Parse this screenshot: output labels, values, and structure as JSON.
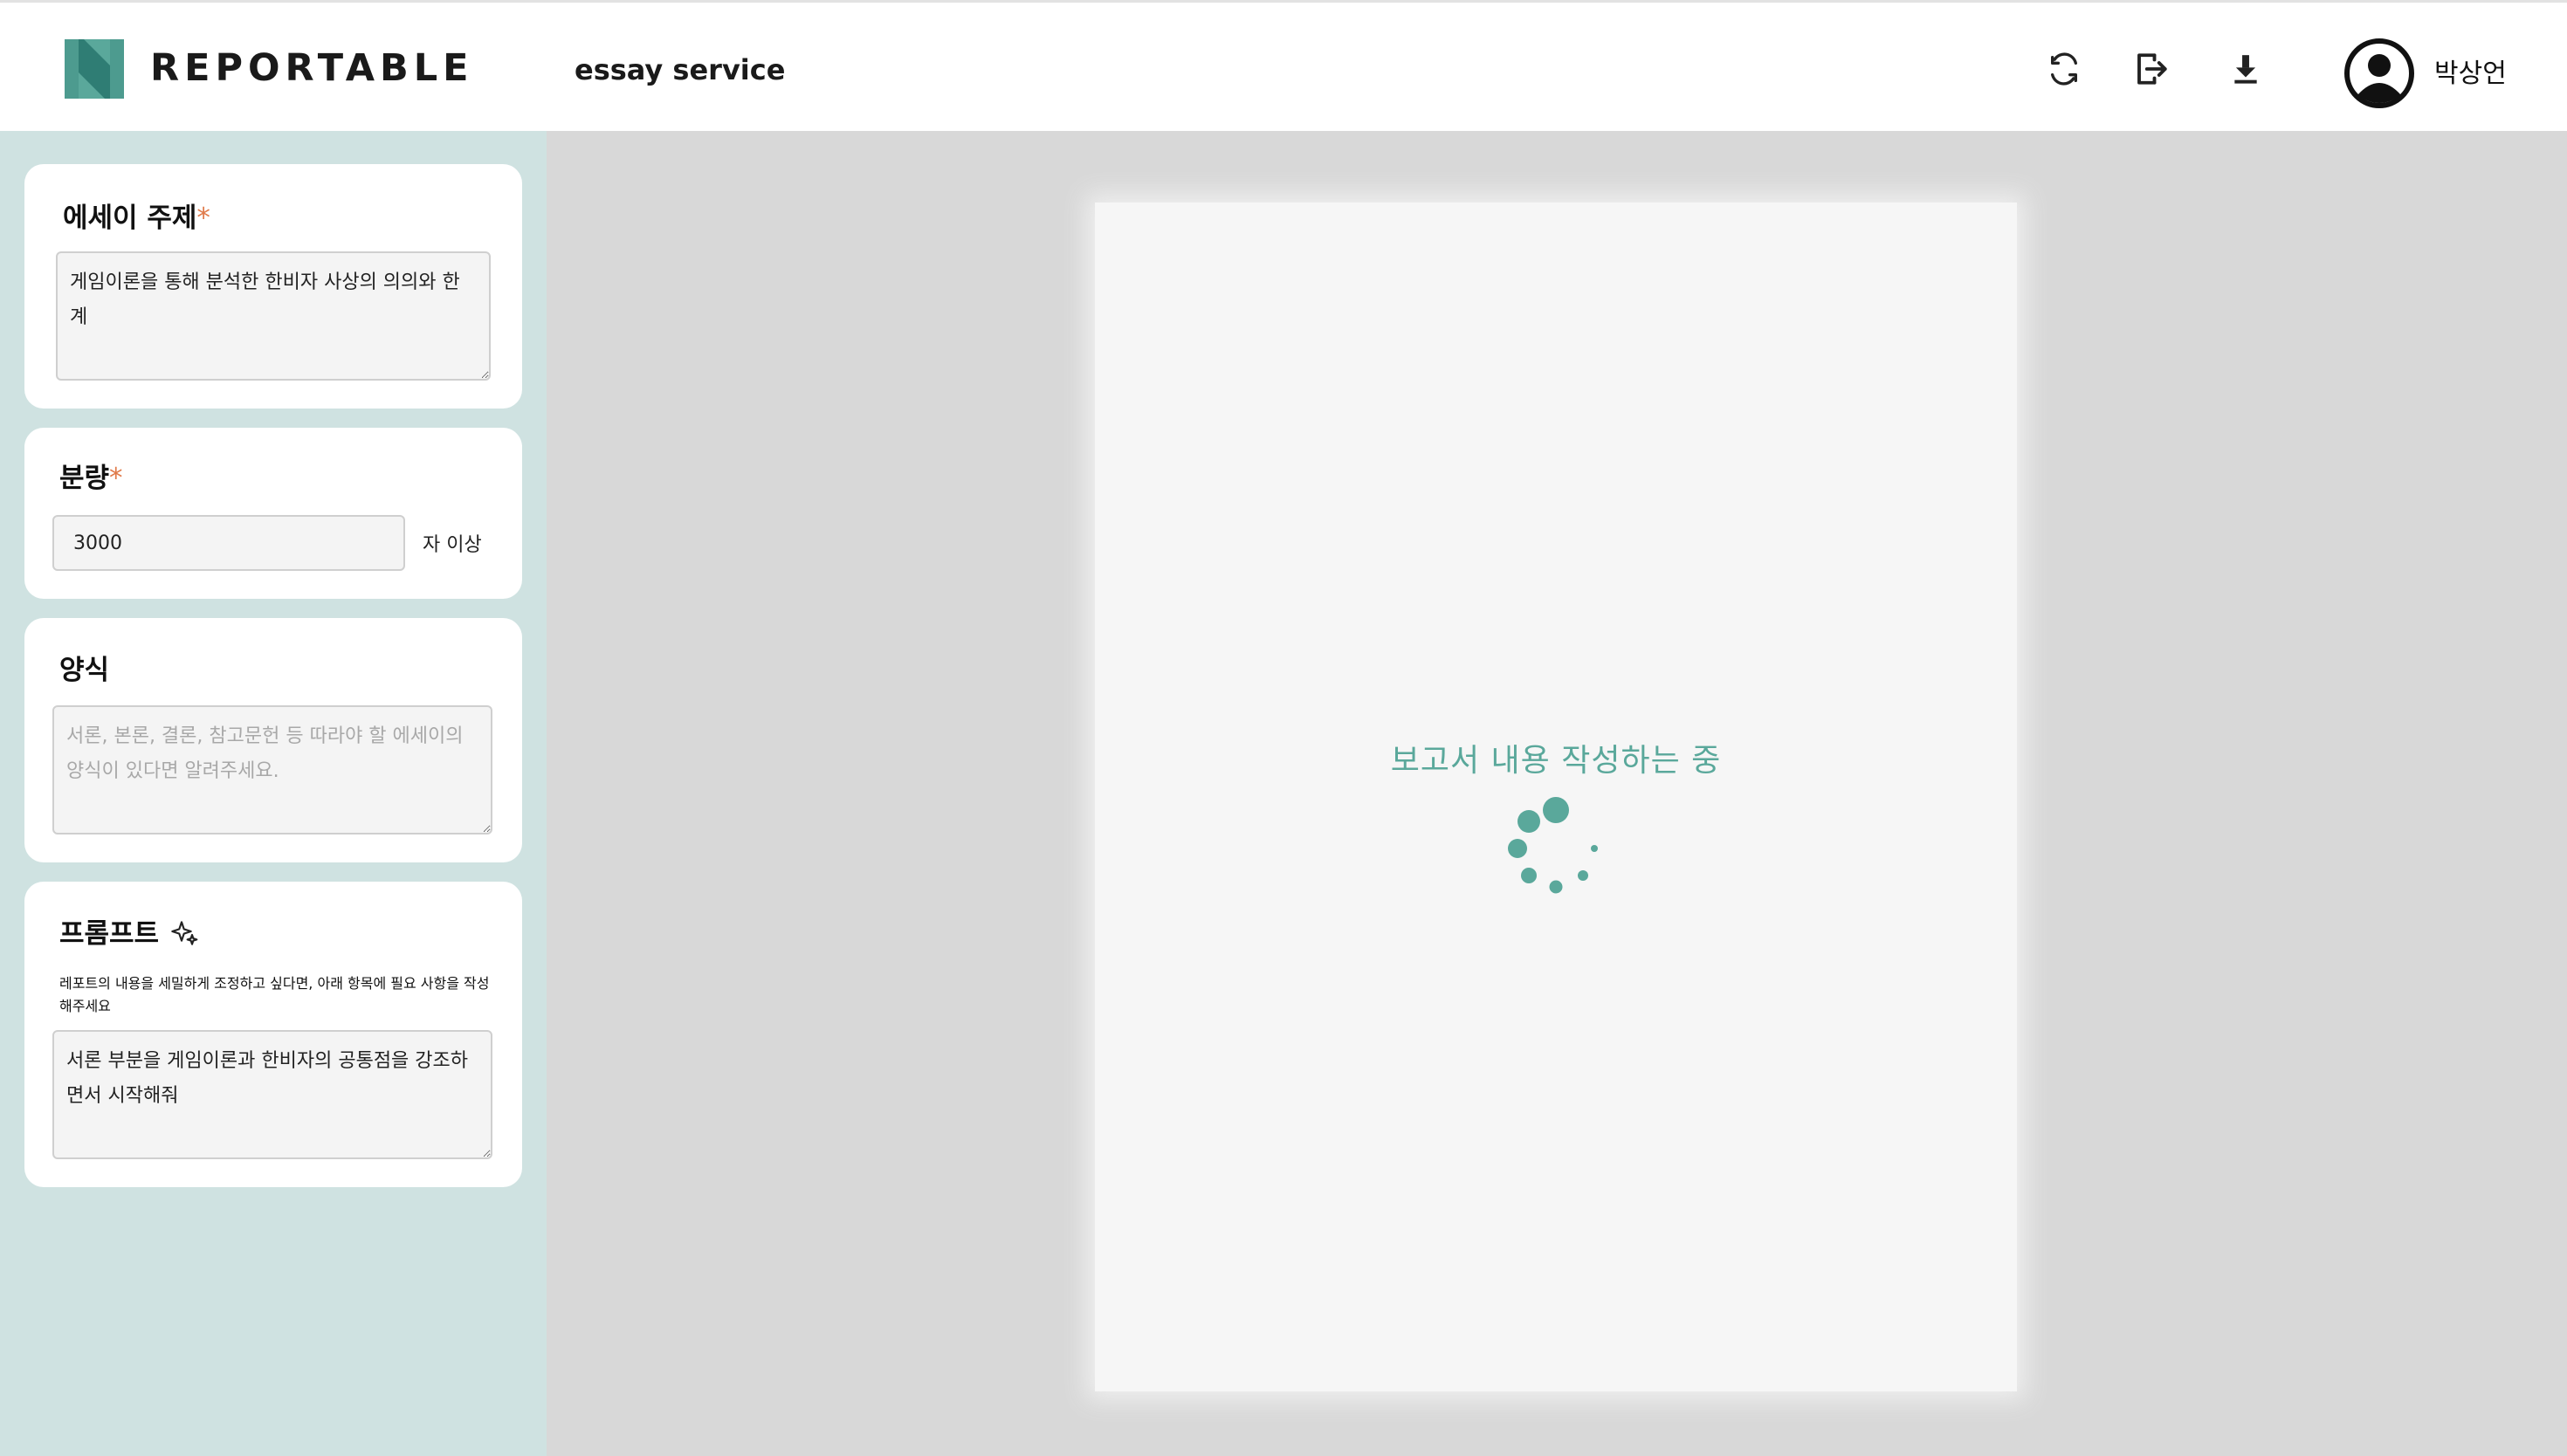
{
  "header": {
    "brand": "REPORTABLE",
    "service": "essay service",
    "user_name": "박상언",
    "icons": [
      "refresh-icon",
      "export-icon",
      "download-icon",
      "user-avatar-icon"
    ]
  },
  "colors": {
    "accent": "#5aa89b",
    "sidebar_bg": "#cfe2e1",
    "main_bg": "#d8d8d8",
    "required_mark": "#e07a4a"
  },
  "sidebar": {
    "topic": {
      "label": "에세이 주제",
      "required_mark": "*",
      "value": "게임이론을 통해 분석한 한비자 사상의 의의와 한계"
    },
    "length": {
      "label": "분량",
      "required_mark": "*",
      "value": "3000",
      "suffix": "자 이상"
    },
    "format": {
      "label": "양식",
      "placeholder": "서론, 본론, 결론, 참고문헌 등 따라야 할 에세이의 양식이 있다면 알려주세요."
    },
    "prompt": {
      "label": "프롬프트",
      "icon": "sparkle-icon",
      "hint": "레포트의 내용을 세밀하게 조정하고 싶다면, 아래 항목에 필요 사항을 작성해주세요",
      "value": "서론 부분을 게임이론과 한비자의 공통점을 강조하면서 시작해줘"
    }
  },
  "main": {
    "loading_text": "보고서 내용 작성하는 중"
  }
}
